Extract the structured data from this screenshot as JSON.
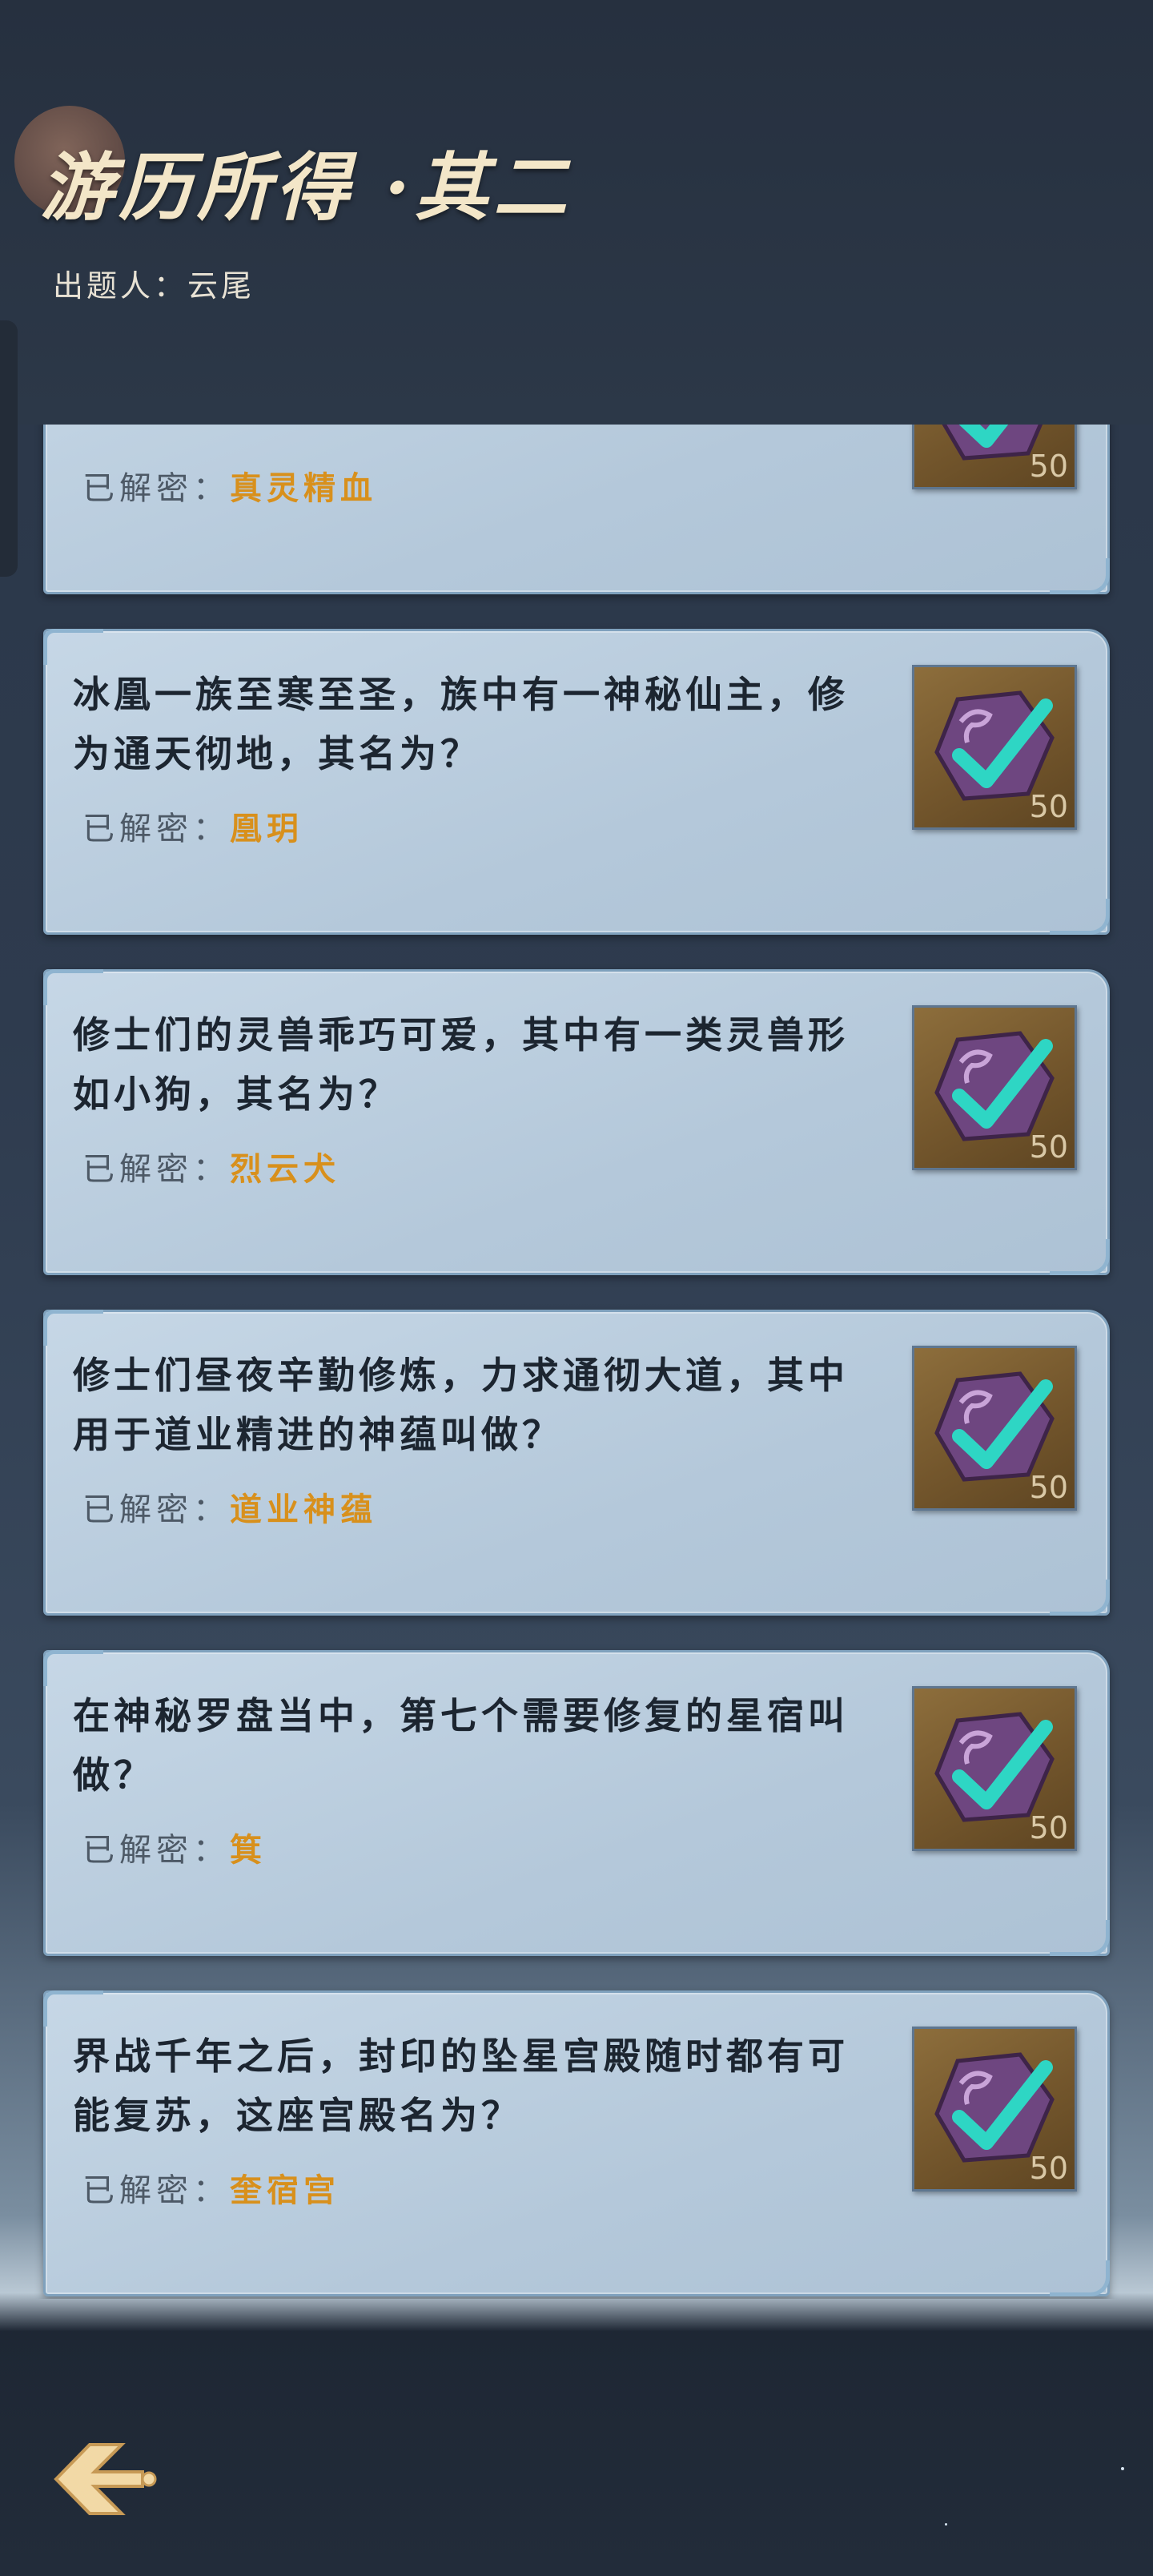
{
  "header": {
    "title": "游历所得 ·其二",
    "author_label": "出题人：",
    "author_name": "云尾"
  },
  "answer_label": "已解密：",
  "cards": [
    {
      "question": "",
      "answer": "真灵精血",
      "reward": "50"
    },
    {
      "question": "冰凰一族至寒至圣，族中有一神秘仙主，修为通天彻地，其名为？",
      "answer": "凰玥",
      "reward": "50"
    },
    {
      "question": "修士们的灵兽乖巧可爱，其中有一类灵兽形如小狗，其名为？",
      "answer": "烈云犬",
      "reward": "50"
    },
    {
      "question": "修士们昼夜辛勤修炼，力求通彻大道，其中用于道业精进的神蕴叫做？",
      "answer": "道业神蕴",
      "reward": "50"
    },
    {
      "question": "在神秘罗盘当中，第七个需要修复的星宿叫做？",
      "answer": "箕",
      "reward": "50"
    },
    {
      "question": "界战千年之后，封印的坠星宫殿随时都有可能复苏，这座宫殿名为？",
      "answer": "奎宿宫",
      "reward": "50"
    }
  ],
  "icons": {
    "badge": "purple-stone-check-icon",
    "back": "back-arrow-icon"
  },
  "colors": {
    "answer_value": "#d8901c",
    "check": "#2ed6c4",
    "stone": "#7a4f8a"
  }
}
